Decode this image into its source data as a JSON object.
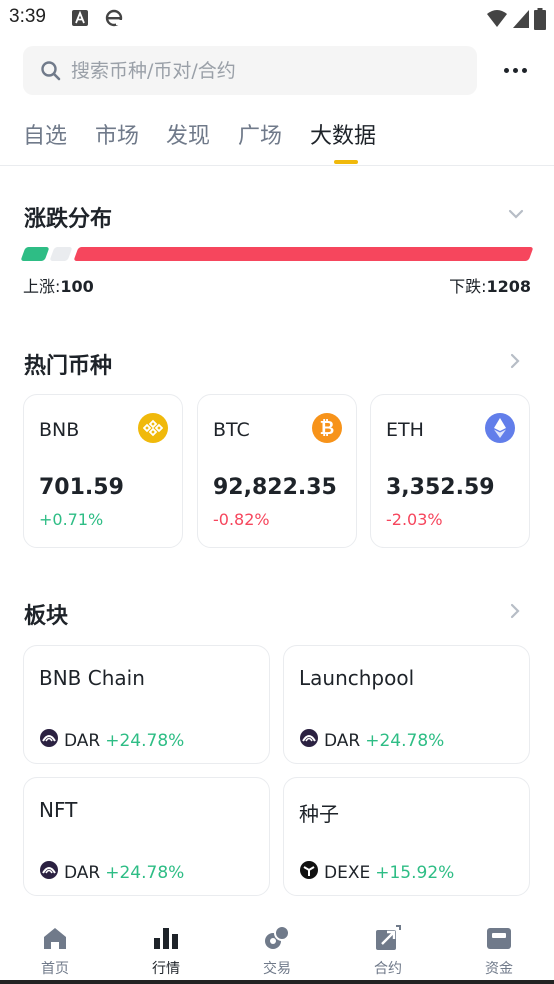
{
  "status_bar": {
    "time": "3:39"
  },
  "search": {
    "placeholder": "搜索币种/币对/合约"
  },
  "tabs": [
    {
      "label": "自选"
    },
    {
      "label": "市场"
    },
    {
      "label": "发现"
    },
    {
      "label": "广场"
    },
    {
      "label": "大数据",
      "active": true
    }
  ],
  "distribution": {
    "title": "涨跌分布",
    "up_label": "上涨:",
    "up_count": "100",
    "down_label": "下跌:",
    "down_count": "1208"
  },
  "hot_coins": {
    "title": "热门币种",
    "items": [
      {
        "symbol": "BNB",
        "price": "701.59",
        "change": "+0.71%",
        "direction": "up",
        "icon": "bnb-icon",
        "color": "#f0b90b"
      },
      {
        "symbol": "BTC",
        "price": "92,822.35",
        "change": "-0.82%",
        "direction": "down",
        "icon": "btc-icon",
        "color": "#f7931a"
      },
      {
        "symbol": "ETH",
        "price": "3,352.59",
        "change": "-2.03%",
        "direction": "down",
        "icon": "eth-icon",
        "color": "#627eea"
      }
    ]
  },
  "sectors": {
    "title": "板块",
    "items": [
      {
        "name": "BNB Chain",
        "token": "DAR",
        "change": "+24.78%",
        "icon": "dar-icon"
      },
      {
        "name": "Launchpool",
        "token": "DAR",
        "change": "+24.78%",
        "icon": "dar-icon"
      },
      {
        "name": "NFT",
        "token": "DAR",
        "change": "+24.78%",
        "icon": "dar-icon"
      },
      {
        "name": "种子",
        "token": "DEXE",
        "change": "+15.92%",
        "icon": "dexe-icon"
      }
    ]
  },
  "bottom_nav": [
    {
      "label": "首页",
      "icon": "home-icon"
    },
    {
      "label": "行情",
      "icon": "markets-icon",
      "active": true
    },
    {
      "label": "交易",
      "icon": "trade-icon"
    },
    {
      "label": "合约",
      "icon": "futures-icon"
    },
    {
      "label": "资金",
      "icon": "wallet-icon"
    }
  ],
  "colors": {
    "up": "#2ebd85",
    "down": "#f6465d",
    "accent": "#f0b90b"
  }
}
